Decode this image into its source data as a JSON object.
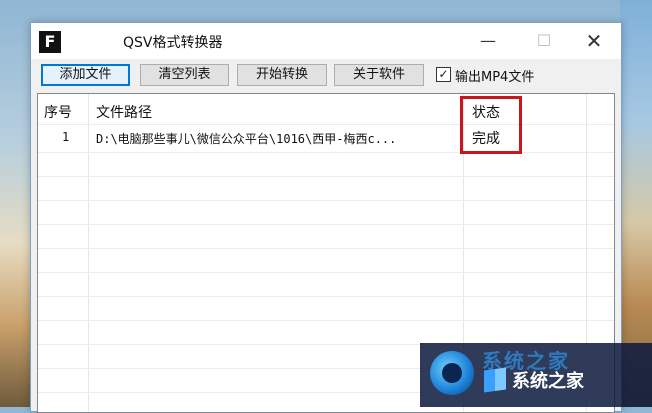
{
  "window": {
    "app_icon_letter": "F",
    "title": "QSV格式转换器",
    "controls": {
      "minimize": "—",
      "maximize": "☐",
      "close": "✕"
    }
  },
  "toolbar": {
    "add_files": "添加文件",
    "clear_list": "清空列表",
    "start_convert": "开始转换",
    "about": "关于软件",
    "output_mp4_label": "输出MP4文件",
    "output_mp4_checked": true
  },
  "table": {
    "headers": {
      "index": "序号",
      "path": "文件路径",
      "status": "状态"
    },
    "rows": [
      {
        "index": "1",
        "path": "D:\\电脑那些事儿\\微信公众平台\\1016\\西甲-梅西c...",
        "status": "完成"
      }
    ]
  },
  "watermark": {
    "text": "系统之家",
    "top_text": "系统之家"
  },
  "colors": {
    "highlight": "#c8161d",
    "accent": "#0078d7"
  }
}
